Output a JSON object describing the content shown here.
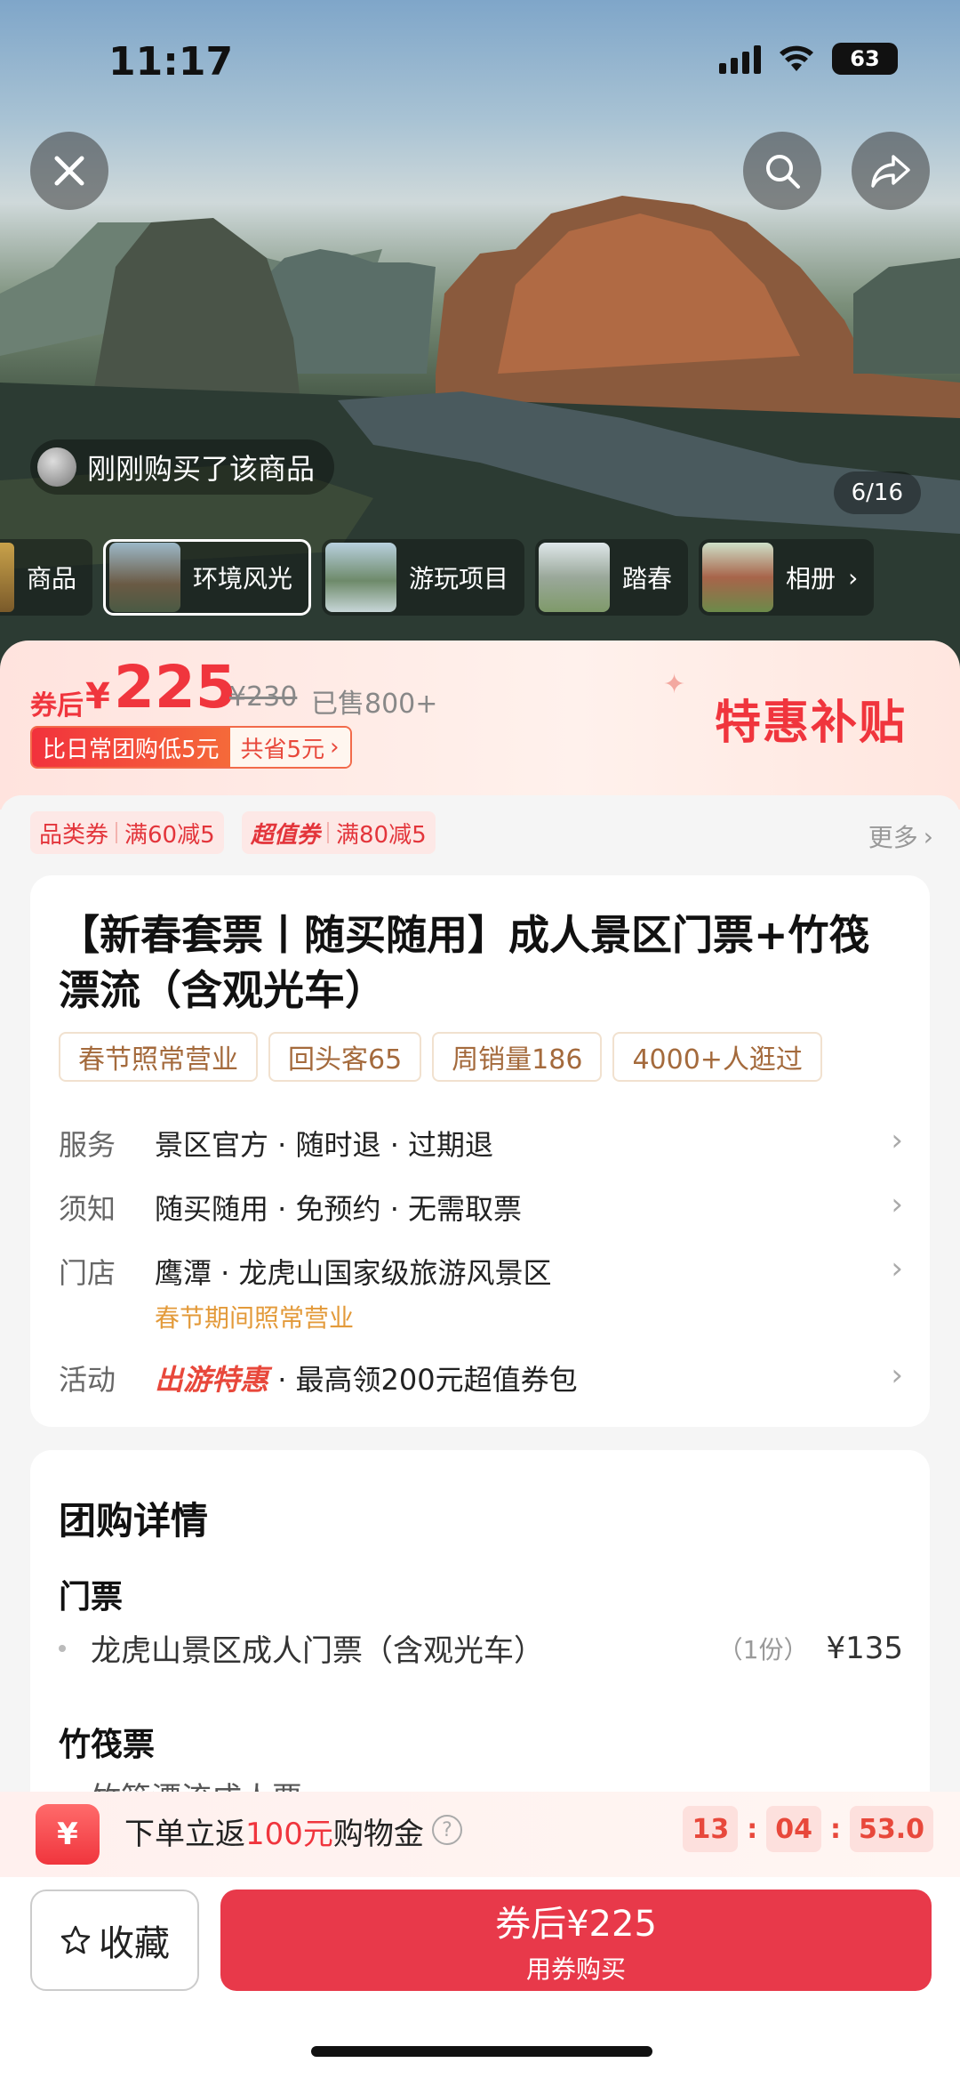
{
  "status_bar": {
    "time": "11:17",
    "battery": "63"
  },
  "hero": {
    "buyer_tip": "刚刚购买了该商品",
    "pager": "6/16",
    "thumbs": [
      "商品",
      "环境风光",
      "游玩项目",
      "踏春",
      "相册"
    ]
  },
  "price": {
    "after_label": "券后",
    "yen": "¥",
    "value": "225",
    "original": "¥230",
    "sold": "已售800+",
    "compare": "比日常团购低5元",
    "saved": "共省5元",
    "badge": "特惠补贴"
  },
  "coupons": {
    "c1_type": "品类券",
    "c1_rule": "满60减5",
    "c2_type": "超值券",
    "c2_rule": "满80减5",
    "more": "更多"
  },
  "product": {
    "title": "【新春套票丨随买随用】成人景区门票+竹筏漂流（含观光车）",
    "chips": [
      "春节照常营业",
      "回头客65",
      "周销量186",
      "4000+人逛过"
    ],
    "service_k": "服务",
    "service_v": "景区官方 · 随时退 · 过期退",
    "notice_k": "须知",
    "notice_v": "随买随用 · 免预约 · 无需取票",
    "store_k": "门店",
    "store_v": "鹰潭 · 龙虎山国家级旅游风景区",
    "store_note": "春节期间照常营业",
    "activity_k": "活动",
    "activity_em": "出游特惠",
    "activity_v": " · 最高领200元超值券包"
  },
  "details": {
    "title": "团购详情",
    "sec1": "门票",
    "item1": "龙虎山景区成人门票（含观光车）",
    "item1_qty": "（1份）",
    "item1_price": "¥135",
    "sec2": "竹筏票",
    "item2_partial": "竹筏漂流成人票"
  },
  "rebate": {
    "pre": "下单立返",
    "amount": "100元",
    "post": "购物金",
    "timer_h": "13",
    "timer_m": "04",
    "timer_s": "53.0"
  },
  "actions": {
    "favorite": "收藏",
    "buy_main": "券后¥225",
    "buy_sub": "用券购买"
  }
}
